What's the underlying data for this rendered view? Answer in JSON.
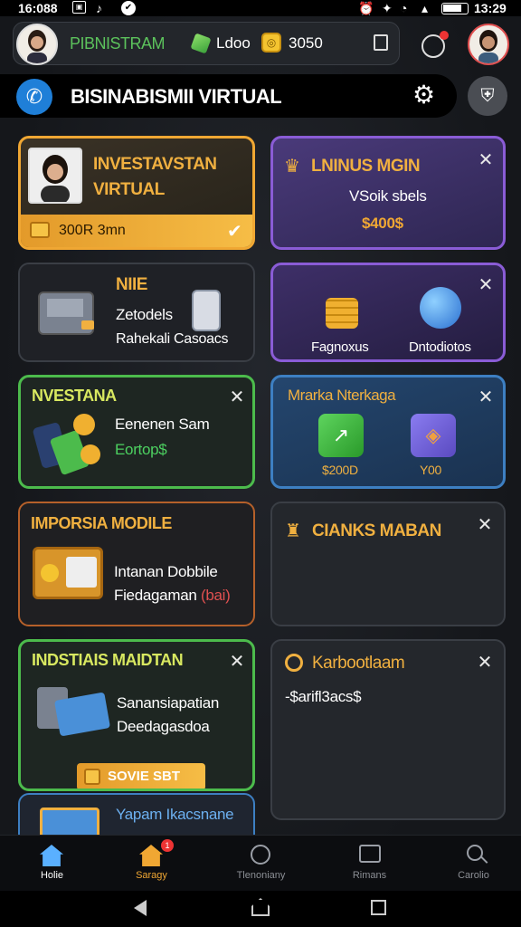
{
  "status_bar": {
    "time_left": "16:088",
    "time_right": "13:29"
  },
  "header": {
    "app_name": "PIBNISTRAM",
    "gems": "Ldoo",
    "coins": "3050"
  },
  "title_bar": {
    "title": "BISINABISMII VIRTUAL"
  },
  "cards": {
    "c1": {
      "title_line1": "INVESTAVSTAN",
      "title_line2": "VIRTUAL",
      "footer": "300R 3mn"
    },
    "c2": {
      "title": "LNINUS MGIN",
      "subtitle": "VSoik sbels",
      "amount": "$400$"
    },
    "c3": {
      "title": "NIIE",
      "line1": "Zetodels",
      "line2": "Rahekali Casoacs"
    },
    "c4": {
      "label1": "Fagnoxus",
      "label2": "Dntodiotos"
    },
    "c5": {
      "title": "NVESTANA",
      "line1": "Eenenen Sam",
      "line2": "Eortop$"
    },
    "c6": {
      "title": "Mrarka Nterkaga",
      "price1": "$200D",
      "price2": "Y00"
    },
    "c7": {
      "title": "IMPORSIA MODILE",
      "line1": "Intanan Dobbile",
      "line2": "Fiedagaman",
      "line2_extra": "(bai)"
    },
    "c8": {
      "title": "CIANKS MABAN"
    },
    "c9": {
      "title": "INDSTIAIS MAIDTAN",
      "line1": "Sanansiapatian",
      "line2": "Deedagasdoa",
      "button": "SOVIE SBT"
    },
    "c10": {
      "title": "Karbootlaam",
      "text": "-$arifl3acs$"
    },
    "c11": {
      "title": "Yapam Ikacsnane"
    }
  },
  "bottom_nav": [
    {
      "label": "Holie"
    },
    {
      "label": "Saragy",
      "badge": "1"
    },
    {
      "label": "Tlenoniany"
    },
    {
      "label": "Rimans"
    },
    {
      "label": "Carolio"
    }
  ],
  "colors": {
    "accent_orange": "#f0a733",
    "accent_purple": "#8a5cd6",
    "accent_green": "#4cbb4c",
    "accent_blue": "#3d7fc2"
  }
}
